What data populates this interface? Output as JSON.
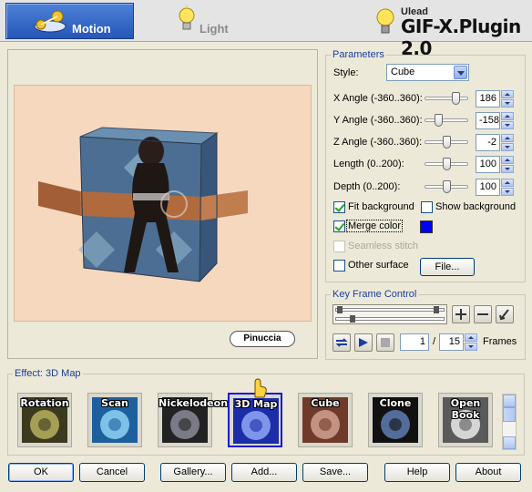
{
  "header": {
    "tabs": [
      {
        "label": "Motion",
        "icon": "motion-icon",
        "active": true
      },
      {
        "label": "Light",
        "icon": "light-bulb-icon",
        "active": false
      }
    ],
    "brand_small": "Ulead",
    "brand_title": "GIF-X.Plugin 2.0"
  },
  "preview": {
    "credit": "Pinuccia"
  },
  "parameters": {
    "title": "Parameters",
    "style_label": "Style:",
    "style_value": "Cube",
    "sliders": [
      {
        "label": "X Angle (-360..360):",
        "value": "186",
        "fraction": 0.76
      },
      {
        "label": "Y Angle (-360..360):",
        "value": "-158",
        "fraction": 0.28
      },
      {
        "label": "Z Angle (-360..360):",
        "value": "-2",
        "fraction": 0.5
      },
      {
        "label": "Length (0..200):",
        "value": "100",
        "fraction": 0.5
      },
      {
        "label": "Depth (0..200):",
        "value": "100",
        "fraction": 0.5
      }
    ],
    "fit_background": {
      "label": "Fit background",
      "checked": true
    },
    "show_background": {
      "label": "Show background",
      "checked": false
    },
    "merge_color": {
      "label": "Merge color",
      "checked": true,
      "color": "#0000FF"
    },
    "seamless_stitch": {
      "label": "Seamless stitch",
      "checked": false,
      "disabled": true
    },
    "other_surface": {
      "label": "Other surface",
      "checked": false
    },
    "file_button": "File..."
  },
  "keyframe": {
    "title": "Key Frame Control",
    "current_frame": "1",
    "separator": "/",
    "total_frames": "15",
    "frames_label": "Frames"
  },
  "effects": {
    "title": "Effect: 3D Map",
    "items": [
      {
        "label": "Rotation",
        "selected": false
      },
      {
        "label": "Scan",
        "selected": false
      },
      {
        "label": "Nickelodeon",
        "selected": false
      },
      {
        "label": "3D Map",
        "selected": true
      },
      {
        "label": "Cube",
        "selected": false
      },
      {
        "label": "Clone",
        "selected": false
      },
      {
        "label": "Open Book",
        "selected": false
      }
    ]
  },
  "footer": {
    "ok": "OK",
    "cancel": "Cancel",
    "gallery": "Gallery...",
    "add": "Add...",
    "save": "Save...",
    "help": "Help",
    "about": "About"
  },
  "colors": {
    "accent": "#2456B8",
    "group_title": "#1A3E9E",
    "preview_bg": "#F6D8BE",
    "merge_color": "#0000FF"
  }
}
